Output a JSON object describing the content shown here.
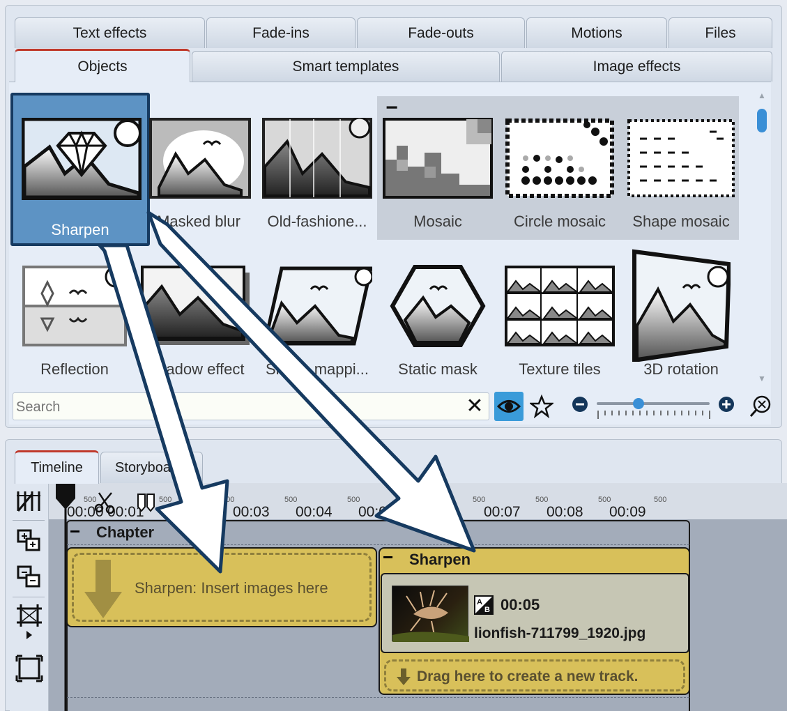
{
  "tabs_row1": [
    "Text effects",
    "Fade-ins",
    "Fade-outs",
    "Motions",
    "Files"
  ],
  "tabs_row2": [
    "Objects",
    "Smart templates",
    "Image effects"
  ],
  "effects": [
    {
      "label": "Sharpen",
      "icon": "sharpen-icon"
    },
    {
      "label": "Masked blur",
      "icon": "masked-blur-icon"
    },
    {
      "label": "Old-fashione...",
      "icon": "old-fashioned-icon"
    },
    {
      "label": "Mosaic",
      "icon": "mosaic-icon"
    },
    {
      "label": "Circle mosaic",
      "icon": "circle-mosaic-icon"
    },
    {
      "label": "Shape mosaic",
      "icon": "shape-mosaic-icon"
    },
    {
      "label": "Reflection",
      "icon": "reflection-icon"
    },
    {
      "label": "Shadow effect",
      "icon": "shadow-effect-icon"
    },
    {
      "label": "Shape mappi...",
      "icon": "shape-mapping-icon"
    },
    {
      "label": "Static mask",
      "icon": "static-mask-icon"
    },
    {
      "label": "Texture tiles",
      "icon": "texture-tiles-icon"
    },
    {
      "label": "3D rotation",
      "icon": "3d-rotation-icon"
    }
  ],
  "group_collapse": "−",
  "search": {
    "placeholder": "Search",
    "clear": "✕"
  },
  "bottom_tabs": [
    "Timeline",
    "Storyboard"
  ],
  "ruler": {
    "times": [
      "00:00",
      "00:01",
      "00:03",
      "00:04",
      "00:0",
      "00:07",
      "00:08",
      "00:09"
    ],
    "sub": "500"
  },
  "chapter": {
    "collapse": "−",
    "title": "Chapter"
  },
  "insert_placeholder": "Sharpen: Insert images here",
  "sharpen_track": {
    "collapse": "−",
    "title": "Sharpen",
    "duration": "00:05",
    "filename": "lionfish-711799_1920.jpg",
    "drag_hint": "Drag here to create a new track."
  },
  "colors": {
    "accent": "#3a9bd9",
    "selection": "#5d93c4",
    "track": "#d8c05a"
  }
}
